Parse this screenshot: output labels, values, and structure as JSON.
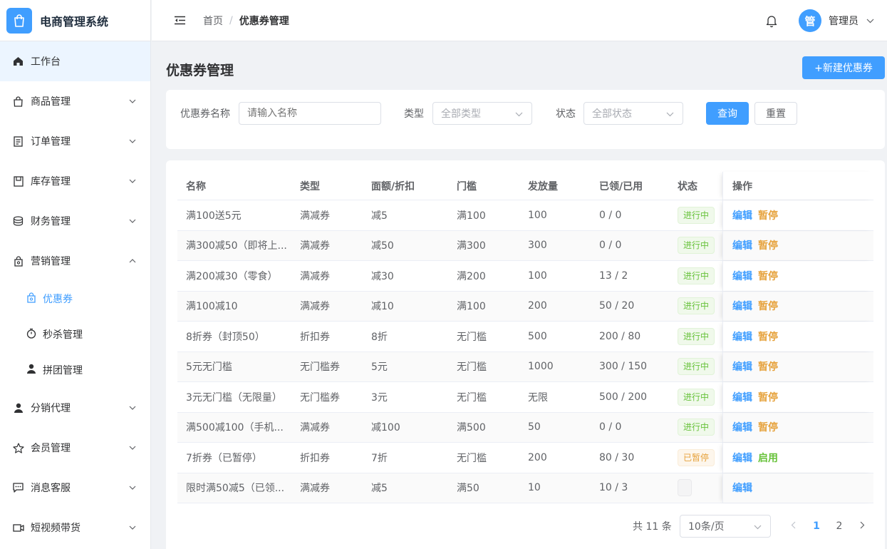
{
  "app": {
    "title": "电商管理系统"
  },
  "sidebar": {
    "items": [
      {
        "label": "工作台",
        "icon": "home-icon"
      },
      {
        "label": "商品管理",
        "icon": "bag-icon"
      },
      {
        "label": "订单管理",
        "icon": "document-icon"
      },
      {
        "label": "库存管理",
        "icon": "box-icon"
      },
      {
        "label": "财务管理",
        "icon": "coins-icon"
      },
      {
        "label": "营销管理",
        "icon": "marketing-icon"
      },
      {
        "label": "优惠券",
        "icon": "coupon-icon"
      },
      {
        "label": "秒杀管理",
        "icon": "stopwatch-icon"
      },
      {
        "label": "拼团管理",
        "icon": "user-icon"
      },
      {
        "label": "分销代理",
        "icon": "user-icon"
      },
      {
        "label": "会员管理",
        "icon": "star-icon"
      },
      {
        "label": "消息客服",
        "icon": "chat-icon"
      },
      {
        "label": "短视频带货",
        "icon": "video-icon"
      }
    ]
  },
  "header": {
    "breadcrumb_home": "首页",
    "breadcrumb_sep": "/",
    "breadcrumb_current": "优惠券管理",
    "user_name": "管理员",
    "avatar_text": "管"
  },
  "page": {
    "title": "优惠券管理",
    "new_button": "+新建优惠券"
  },
  "filter": {
    "name_label": "优惠券名称",
    "name_placeholder": "请输入名称",
    "type_label": "类型",
    "type_value": "全部类型",
    "status_label": "状态",
    "status_value": "全部状态",
    "query_button": "查询",
    "reset_button": "重置"
  },
  "table": {
    "columns": [
      "名称",
      "类型",
      "面额/折扣",
      "门槛",
      "发放量",
      "已领/已用",
      "状态",
      "操作"
    ],
    "rows": [
      {
        "name": "满100送5元",
        "type": "满减券",
        "value": "减5",
        "threshold": "满100",
        "qty": "100",
        "used": "0 / 0",
        "status": "进行中",
        "edit": "编辑",
        "action": "暂停"
      },
      {
        "name": "满300减50（即将上...",
        "type": "满减券",
        "value": "减50",
        "threshold": "满300",
        "qty": "300",
        "used": "0 / 0",
        "status": "进行中",
        "edit": "编辑",
        "action": "暂停"
      },
      {
        "name": "满200减30（零食）",
        "type": "满减券",
        "value": "减30",
        "threshold": "满200",
        "qty": "100",
        "used": "13 / 2",
        "status": "进行中",
        "edit": "编辑",
        "action": "暂停"
      },
      {
        "name": "满100减10",
        "type": "满减券",
        "value": "减10",
        "threshold": "满100",
        "qty": "200",
        "used": "50 / 20",
        "status": "进行中",
        "edit": "编辑",
        "action": "暂停"
      },
      {
        "name": "8折券（封顶50）",
        "type": "折扣券",
        "value": "8折",
        "threshold": "无门槛",
        "qty": "500",
        "used": "200 / 80",
        "status": "进行中",
        "edit": "编辑",
        "action": "暂停"
      },
      {
        "name": "5元无门槛",
        "type": "无门槛券",
        "value": "5元",
        "threshold": "无门槛",
        "qty": "1000",
        "used": "300 / 150",
        "status": "进行中",
        "edit": "编辑",
        "action": "暂停"
      },
      {
        "name": "3元无门槛（无限量）",
        "type": "无门槛券",
        "value": "3元",
        "threshold": "无门槛",
        "qty": "无限",
        "used": "500 / 200",
        "status": "进行中",
        "edit": "编辑",
        "action": "暂停"
      },
      {
        "name": "满500减100（手机...",
        "type": "满减券",
        "value": "减100",
        "threshold": "满500",
        "qty": "50",
        "used": "0 / 0",
        "status": "进行中",
        "edit": "编辑",
        "action": "暂停"
      },
      {
        "name": "7折券（已暂停）",
        "type": "折扣券",
        "value": "7折",
        "threshold": "无门槛",
        "qty": "200",
        "used": "80 / 30",
        "status": "已暂停",
        "edit": "编辑",
        "action": "启用"
      },
      {
        "name": "限时满50减5（已领...",
        "type": "满减券",
        "value": "减5",
        "threshold": "满50",
        "qty": "10",
        "used": "10 / 3",
        "status": "",
        "edit": "编辑",
        "action": ""
      }
    ]
  },
  "pagination": {
    "total": "共 11 条",
    "page_size": "10条/页",
    "pages": [
      "1",
      "2"
    ],
    "current": "1"
  },
  "colors": {
    "primary": "#409eff",
    "success": "#67c23a",
    "warning": "#e6a23c"
  }
}
